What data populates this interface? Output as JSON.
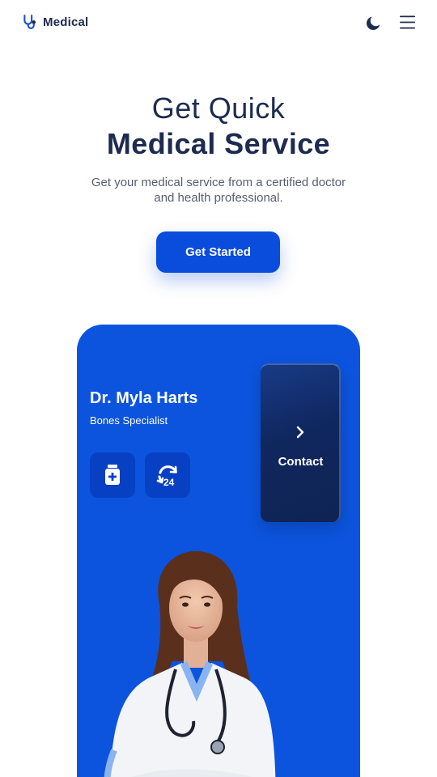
{
  "header": {
    "brand": "Medical",
    "logo_icon": "stethoscope-icon",
    "theme_icon": "moon-icon",
    "menu_icon": "hamburger-menu-icon"
  },
  "hero": {
    "title_line1": "Get Quick",
    "title_line2": "Medical Service",
    "description": "Get your medical service from a certified doctor and health professional.",
    "cta_label": "Get Started"
  },
  "doctor_card": {
    "name": "Dr. Myla Harts",
    "specialty": "Bones Specialist",
    "service_icons": [
      "medicine-bottle-icon",
      "24-hours-icon"
    ],
    "contact_label": "Contact",
    "contact_icon": "chevron-right-icon",
    "colors": {
      "card": "#0c54dd",
      "service_tile": "#0840c4",
      "contact_panel": "#10275e"
    }
  },
  "colors": {
    "primary": "#0a4ddc",
    "text_dark": "#1d2b4f",
    "text_muted": "#575e6e"
  }
}
